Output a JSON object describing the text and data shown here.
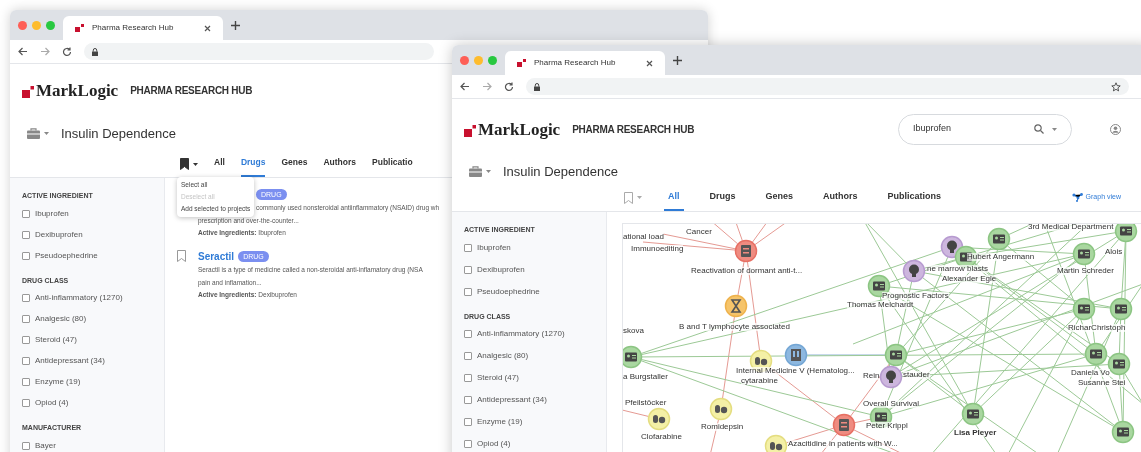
{
  "back_window": {
    "tab_title": "Pharma Research Hub",
    "brand": {
      "logo": "MarkLogic",
      "product": "PHARMA RESEARCH HUB"
    },
    "project": "Insulin Dependence",
    "tabs": [
      {
        "label": "All",
        "selected": false
      },
      {
        "label": "Drugs",
        "selected": true
      },
      {
        "label": "Genes",
        "selected": false
      },
      {
        "label": "Authors",
        "selected": false
      },
      {
        "label": "Publicatio",
        "selected": false
      }
    ],
    "bookmark_menu": [
      {
        "label": "Select all",
        "disabled": false
      },
      {
        "label": "Deselect all",
        "disabled": true
      },
      {
        "label": "Add selected to projects",
        "disabled": false
      }
    ],
    "filters": [
      {
        "heading": "ACTIVE INGREDIENT",
        "options": [
          {
            "label": "Ibuprofen",
            "checked": false
          },
          {
            "label": "Dexibuprofen",
            "checked": false
          },
          {
            "label": "Pseudoephedrine",
            "checked": false
          }
        ]
      },
      {
        "heading": "DRUG CLASS",
        "options": [
          {
            "label": "Anti-inflammatory (1270)",
            "checked": false
          },
          {
            "label": "Analgesic (80)",
            "checked": false
          },
          {
            "label": "Steroid (47)",
            "checked": false
          },
          {
            "label": "Antidepressant (34)",
            "checked": false
          },
          {
            "label": "Enzyme (19)",
            "checked": false
          },
          {
            "label": "Opiod (4)",
            "checked": false
          }
        ]
      },
      {
        "heading": "MANUFACTURER",
        "options": [
          {
            "label": "Bayer",
            "checked": false
          }
        ]
      }
    ],
    "results": [
      {
        "badge": "DRUG",
        "lines": [
          "commonly used nonsteroidal antiinflammatory (NSAID) drug wh",
          "prescription and over-the-counter..."
        ],
        "ingredients": "**Active Ingredients:** Ibuprofen"
      },
      {
        "title": "Seractil",
        "badge": "DRUG",
        "lines": [
          "Seractil is a type of medicine called a non-steroidal anti-inflamatory drug (NSA",
          "pain and inflamation..."
        ],
        "ingredients": "**Active Ingredients:** Dexibuprofen"
      }
    ]
  },
  "front_window": {
    "tab_title": "Pharma Research Hub",
    "brand": {
      "logo": "MarkLogic",
      "product": "PHARMA RESEARCH HUB"
    },
    "search": {
      "value": "Ibuprofen"
    },
    "project": "Insulin Dependence",
    "tabs": [
      {
        "label": "All",
        "selected": true
      },
      {
        "label": "Drugs",
        "selected": false
      },
      {
        "label": "Genes",
        "selected": false
      },
      {
        "label": "Authors",
        "selected": false
      },
      {
        "label": "Publications",
        "selected": false
      }
    ],
    "graph_view": "Graph view",
    "filters": [
      {
        "heading": "ACTIVE INGREDIENT",
        "options": [
          {
            "label": "Ibuprofen",
            "checked": false
          },
          {
            "label": "Dexibuprofen",
            "checked": false
          },
          {
            "label": "Pseudoephedrine",
            "checked": false
          }
        ]
      },
      {
        "heading": "DRUG CLASS",
        "options": [
          {
            "label": "Anti-inflammatory (1270)",
            "checked": false
          },
          {
            "label": "Analgesic (80)",
            "checked": false
          },
          {
            "label": "Steroid (47)",
            "checked": false
          },
          {
            "label": "Antidepressant (34)",
            "checked": false
          },
          {
            "label": "Enzyme (19)",
            "checked": false
          },
          {
            "label": "Opiod (4)",
            "checked": false
          }
        ]
      }
    ],
    "graph": {
      "nodes": [
        {
          "kind": "study"
        },
        {
          "kind": "gene"
        },
        {
          "kind": "drug"
        },
        {
          "kind": "department"
        },
        {
          "kind": "drug"
        },
        {
          "kind": "drug"
        },
        {
          "kind": "study"
        },
        {
          "kind": "drug"
        },
        {
          "kind": "person"
        },
        {
          "kind": "person"
        },
        {
          "kind": "person"
        },
        {
          "kind": "topic"
        },
        {
          "kind": "topic"
        },
        {
          "kind": "topic"
        },
        {
          "kind": "person"
        },
        {
          "kind": "person"
        },
        {
          "kind": "person"
        },
        {
          "kind": "person"
        },
        {
          "kind": "person"
        },
        {
          "kind": "person"
        },
        {
          "kind": "person"
        },
        {
          "kind": "person"
        },
        {
          "kind": "person"
        },
        {
          "kind": "person"
        },
        {
          "kind": "person"
        }
      ],
      "labels": [
        {
          "text": "ational load",
          "bold": false
        },
        {
          "text": "Cancer",
          "bold": false
        },
        {
          "text": "3rd Medical Department",
          "bold": false
        },
        {
          "text": "Immunoediting",
          "bold": false
        },
        {
          "text": "Hubert Angermann",
          "bold": false
        },
        {
          "text": "Alois",
          "bold": false
        },
        {
          "text": "Reactivation of dormant anti-t...",
          "bold": false
        },
        {
          "text": "ne marrow blasts",
          "bold": false
        },
        {
          "text": "Martin Schreder",
          "bold": false
        },
        {
          "text": "Alexander Egle",
          "bold": false
        },
        {
          "text": "Prognostic Factors",
          "bold": false
        },
        {
          "text": "Thomas Melchardt",
          "bold": false
        },
        {
          "text": "skova",
          "bold": false
        },
        {
          "text": "B and T lymphocyte associated",
          "bold": false
        },
        {
          "text": "RicharChristoph",
          "bold": false
        },
        {
          "text": "a Burgstaller",
          "bold": false
        },
        {
          "text": "Internal Medicine V (Hematolog...",
          "bold": false
        },
        {
          "text": "Rein",
          "bold": false
        },
        {
          "text": "stauder",
          "bold": false
        },
        {
          "text": "Daniela Vo",
          "bold": false
        },
        {
          "text": "cytarabine",
          "bold": false
        },
        {
          "text": "Susanne Stei",
          "bold": false
        },
        {
          "text": "Pfeilstöcker",
          "bold": false
        },
        {
          "text": "Overall Survival",
          "bold": false
        },
        {
          "text": "Romidepsin",
          "bold": false
        },
        {
          "text": "Peter Krippl",
          "bold": false
        },
        {
          "text": "Clofarabine",
          "bold": false
        },
        {
          "text": "Lisa Pleyer",
          "bold": true
        },
        {
          "text": "Azacitidine in patients with W...",
          "bold": false
        }
      ]
    }
  }
}
